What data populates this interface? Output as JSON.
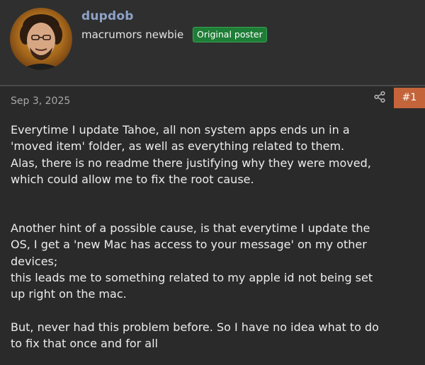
{
  "user": {
    "name": "dupdob",
    "title": "macrumors newbie",
    "badge": "Original poster",
    "avatar_icon": "user-avatar-photo"
  },
  "post": {
    "date": "Sep 3, 2025",
    "number": "#1",
    "share_icon": "share-icon",
    "paragraphs": [
      "Everytime I update Tahoe, all non system apps ends un in a\n'moved item' folder, as well as everything related to them.\nAlas, there is no readme there justifying why they were moved,\nwhich could allow me to fix the root cause.",
      "Another hint of a possible cause, is that everytime I update the\nOS, I get a 'new Mac has access to your message' on my other\ndevices;\nthis leads me to something related to my apple id not being set\nup right on the mac.",
      "But, never had this problem before. So I have no idea what to do\nto fix that once and for all"
    ]
  },
  "colors": {
    "background": "#2a2a2a",
    "username": "#8ea2c8",
    "badge_bg": "#1e7d36",
    "post_number_bg": "#c4643a"
  }
}
